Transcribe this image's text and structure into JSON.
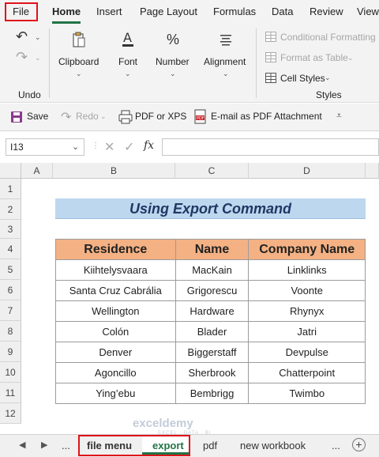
{
  "menu": {
    "items": [
      "File",
      "Home",
      "Insert",
      "Page Layout",
      "Formulas",
      "Data",
      "Review",
      "View"
    ]
  },
  "ribbon": {
    "undo_label": "Undo",
    "clipboard_label": "Clipboard",
    "font_label": "Font",
    "number_label": "Number",
    "alignment_label": "Alignment",
    "styles": {
      "conditional": "Conditional Formatting",
      "format_table": "Format as Table",
      "cell_styles": "Cell Styles",
      "group_label": "Styles"
    }
  },
  "qat": {
    "save": "Save",
    "redo": "Redo",
    "pdf": "PDF or XPS",
    "email": "E-mail as PDF Attachment"
  },
  "formula_bar": {
    "name_box": "I13",
    "fx": "fx",
    "formula": ""
  },
  "grid": {
    "columns": [
      "A",
      "B",
      "C",
      "D"
    ],
    "rows": [
      "1",
      "2",
      "3",
      "4",
      "5",
      "6",
      "7",
      "8",
      "9",
      "10",
      "11",
      "12"
    ],
    "title": "Using Export Command",
    "headers": [
      "Residence",
      "Name",
      "Company Name"
    ],
    "data": [
      [
        "Kiihtelysvaara",
        "MacKain",
        "Linklinks"
      ],
      [
        "Santa Cruz Cabrália",
        "Grigorescu",
        "Voonte"
      ],
      [
        "Wellington",
        "Hardware",
        "Rhynyx"
      ],
      [
        "Colón",
        "Blader",
        "Jatri"
      ],
      [
        "Denver",
        "Biggerstaff",
        "Devpulse"
      ],
      [
        "Agoncillo",
        "Sherbrook",
        "Chatterpoint"
      ],
      [
        "Ying’ebu",
        "Bembrigg",
        "Twimbo"
      ]
    ]
  },
  "sheets": {
    "tabs": [
      "file menu",
      "export",
      "pdf",
      "new workbook"
    ],
    "active": "export",
    "more": "...",
    "add": "+"
  },
  "watermark": {
    "brand": "exceldemy",
    "tagline": "EXCEL · DATA · BI"
  },
  "colors": {
    "excel_green": "#217346",
    "highlight_red": "#e0121a",
    "title_fill": "#bdd7ee",
    "header_fill": "#f4b183"
  }
}
